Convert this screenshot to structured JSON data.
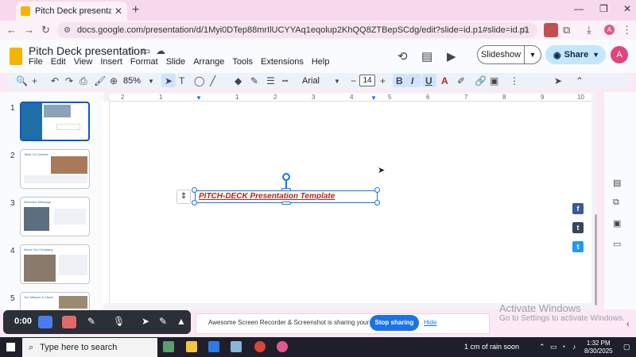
{
  "browser": {
    "tab_title": "Pitch Deck presentation - Goog",
    "url": "docs.google.com/presentation/d/1Myi0DTep88mrIlUCYYAq1eqolup2KhQQ8ZTBepSCdg/edit?slide=id.p1#slide=id.p1",
    "profile_initial": "A"
  },
  "app": {
    "doc_title": "Pitch Deck presentation",
    "menu": [
      "File",
      "Edit",
      "View",
      "Insert",
      "Format",
      "Slide",
      "Arrange",
      "Tools",
      "Extensions",
      "Help"
    ],
    "slideshow_label": "Slideshow",
    "share_label": "Share",
    "avatar_initial": "A"
  },
  "toolbar": {
    "zoom": "85%",
    "font": "Arial",
    "font_size": "14",
    "bold": "B",
    "italic": "I",
    "underline": "U",
    "text_color": "A"
  },
  "ruler": {
    "labels": [
      "2",
      "1",
      "1",
      "2",
      "3",
      "4",
      "5",
      "6",
      "7",
      "8",
      "9",
      "10"
    ]
  },
  "slides": [
    {
      "num": "1",
      "label": "PITCH-DECK"
    },
    {
      "num": "2",
      "label": "Table Of Content"
    },
    {
      "num": "3",
      "label": "Welcome Message"
    },
    {
      "num": "4",
      "label": "About Our Company"
    },
    {
      "num": "5",
      "label": "Our Mission & Vision"
    }
  ],
  "canvas": {
    "textbox_text": "PITCH-DECK Presentation Template"
  },
  "watermark": {
    "title": "Activate Windows",
    "subtitle": "Go to Settings to activate Windows."
  },
  "recorder": {
    "time": "0:00"
  },
  "sharing": {
    "message": "Awesome Screen Recorder & Screenshot is sharing your screen.",
    "stop_label": "Stop sharing",
    "hide_label": "Hide"
  },
  "taskbar": {
    "search_placeholder": "Type here to search",
    "weather": "1 cm of rain soon",
    "time": "1:32 PM",
    "date": "8/30/2025"
  },
  "colors": {
    "accent": "#1a73e8",
    "textbox_text": "#b3261e",
    "slide_theme": "#1e6fa8"
  }
}
